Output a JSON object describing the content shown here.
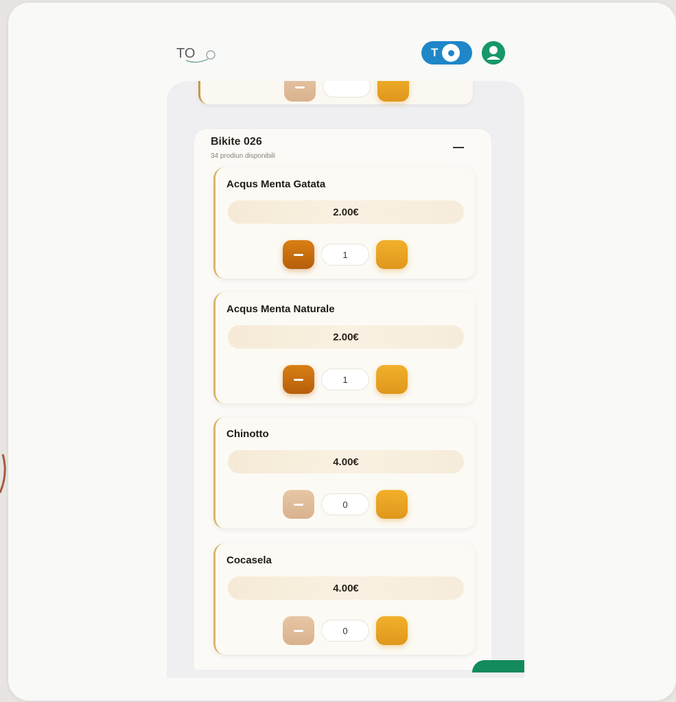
{
  "header": {
    "logo_text": "TO",
    "toggle_label": "T"
  },
  "colors": {
    "accent_orange": "#d97f15",
    "plus_orange": "#f1b02a",
    "toggle_blue": "#1f87c8",
    "avatar_green": "#17986a"
  },
  "category": {
    "title": "Bikite 026",
    "subtitle": "34 prodiun disponibili"
  },
  "products": [
    {
      "name": "Acqus Menta Gatata",
      "price": "2.00€",
      "qty": "1",
      "minus_enabled": true
    },
    {
      "name": "Acqus Menta Naturale",
      "price": "2.00€",
      "qty": "1",
      "minus_enabled": true
    },
    {
      "name": "Chinotto",
      "price": "4.00€",
      "qty": "0",
      "minus_enabled": false
    },
    {
      "name": "Cocasela",
      "price": "4.00€",
      "qty": "0",
      "minus_enabled": false
    }
  ]
}
